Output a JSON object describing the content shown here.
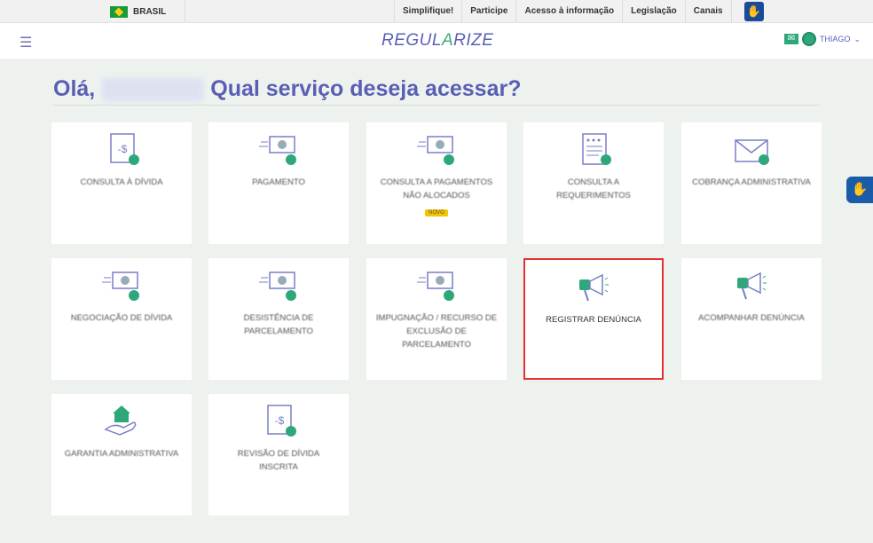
{
  "gov_bar": {
    "country": "BRASIL",
    "links": [
      "Simplifique!",
      "Participe",
      "Acesso à informação",
      "Legislação",
      "Canais"
    ]
  },
  "header": {
    "logo_left": "REGUL",
    "logo_mark": "A",
    "logo_right": "RIZE",
    "user": "THIAGO"
  },
  "greeting": {
    "hello": "Olá,",
    "question": "Qual serviço deseja acessar?"
  },
  "colors": {
    "accent": "#5a5fb5",
    "green": "#2ea87a",
    "highlight": "#e53030"
  },
  "services": [
    {
      "label": "CONSULTA À DÍVIDA",
      "icon": "doc-dollar-search-icon"
    },
    {
      "label": "PAGAMENTO",
      "icon": "money-check-icon"
    },
    {
      "label": "CONSULTA A PAGAMENTOS NÃO ALOCADOS",
      "icon": "money-question-icon",
      "badge": "NOVO"
    },
    {
      "label": "CONSULTA A REQUERIMENTOS",
      "icon": "document-search-icon"
    },
    {
      "label": "COBRANÇA ADMINISTRATIVA",
      "icon": "envelope-dollar-icon"
    },
    {
      "label": "NEGOCIAÇÃO DE DÍVIDA",
      "icon": "money-check-icon"
    },
    {
      "label": "DESISTÊNCIA DE PARCELAMENTO",
      "icon": "money-back-icon"
    },
    {
      "label": "IMPUGNAÇÃO / RECURSO DE EXCLUSÃO DE PARCELAMENTO",
      "icon": "money-x-icon"
    },
    {
      "label": "REGISTRAR DENÚNCIA",
      "icon": "megaphone-icon",
      "highlighted": true
    },
    {
      "label": "ACOMPANHAR DENÚNCIA",
      "icon": "megaphone-icon"
    },
    {
      "label": "GARANTIA ADMINISTRATIVA",
      "icon": "house-hand-icon"
    },
    {
      "label": "REVISÃO DE DÍVIDA INSCRITA",
      "icon": "doc-dollar-edit-icon"
    }
  ]
}
